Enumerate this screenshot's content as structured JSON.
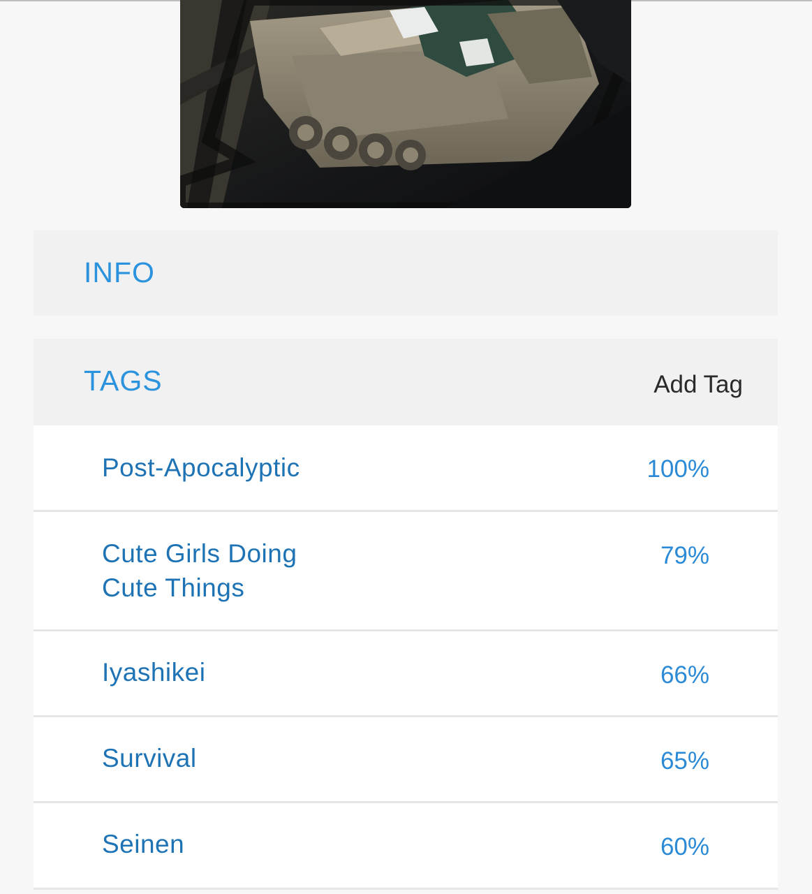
{
  "sections": {
    "info": {
      "title": "INFO"
    },
    "tags": {
      "title": "TAGS",
      "add_label": "Add Tag"
    }
  },
  "tags": [
    {
      "name": "Post-Apocalyptic",
      "percent": "100%"
    },
    {
      "name": "Cute Girls Doing Cute Things",
      "percent": "79%"
    },
    {
      "name": "Iyashikei",
      "percent": "66%"
    },
    {
      "name": "Survival",
      "percent": "65%"
    },
    {
      "name": "Seinen",
      "percent": "60%"
    }
  ],
  "colors": {
    "accent": "#2b93de",
    "tag_text": "#1e73b5",
    "panel_bg": "#f1f1f1",
    "page_bg": "#f7f7f7"
  }
}
